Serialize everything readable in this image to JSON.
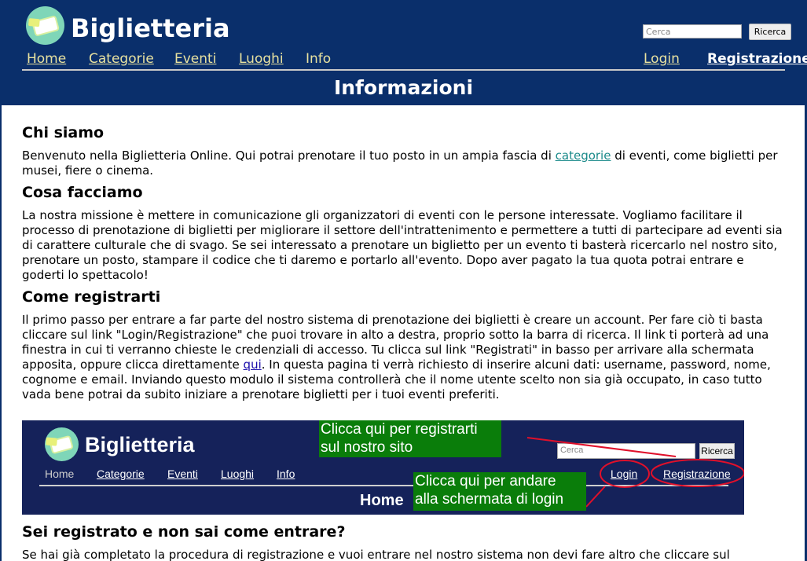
{
  "header": {
    "site_title": "Biglietteria",
    "search": {
      "placeholder": "Cerca",
      "button_label": "Ricerca"
    },
    "nav": {
      "home": "Home",
      "categorie": "Categorie",
      "eventi": "Eventi",
      "luoghi": "Luoghi",
      "info": "Info",
      "login": "Login",
      "registrazione": "Registrazione"
    },
    "page_heading": "Informazioni"
  },
  "sections": {
    "chi_siamo": {
      "title": "Chi siamo",
      "text_before_link": "Benvenuto nella Biglietteria Online. Qui potrai prenotare il tuo posto in un ampia fascia di ",
      "link_text": "categorie",
      "text_after_link": " di eventi, come biglietti per musei, fiere o cinema."
    },
    "cosa_facciamo": {
      "title": "Cosa facciamo",
      "text": "La nostra missione è mettere in comunicazione gli organizzatori di eventi con le persone interessate. Vogliamo facilitare il processo di prenotazione di biglietti per migliorare il settore dell'intrattenimento e permettere a tutti di partecipare ad eventi sia di carattere culturale che di svago. Se sei interessato a prenotare un biglietto per un evento ti basterà ricercarlo nel nostro sito, prenotare un posto, stampare il codice che ti daremo e portarlo all'evento. Dopo aver pagato la tua quota potrai entrare e goderti lo spettacolo!"
    },
    "come_registrarti": {
      "title": "Come registrarti",
      "text_before_link": "Il primo passo per entrare a far parte del nostro sistema di prenotazione dei biglietti è creare un account. Per fare ciò ti basta cliccare sul link \"Login/Registrazione\" che puoi trovare in alto a destra, proprio sotto la barra di ricerca. Il link ti porterà ad una finestra in cui ti verranno chieste le credenziali di accesso. Tu clicca sul link \"Registrati\" in basso per arrivare alla schermata apposita, oppure clicca direttamente ",
      "link_text": "qui",
      "text_after_link": ". In questa pagina ti verrà richiesto di inserire alcuni dati: username, password, nome, cognome e email. Inviando questo modulo il sistema controllerà che il nome utente scelto non sia già occupato, in caso tutto vada bene potrai da subito iniziare a prenotare biglietti per i tuoi eventi preferiti."
    },
    "sei_registrato": {
      "title": "Sei registrato e non sai come entrare?",
      "text": "Se hai già completato la procedura di registrazione e vuoi entrare nel nostro sistema non devi fare altro che cliccare sul"
    }
  },
  "screenshot": {
    "site_title": "Biglietteria",
    "search_placeholder": "Cerca",
    "search_button": "Ricerca",
    "nav": {
      "home": "Home",
      "categorie": "Categorie",
      "eventi": "Eventi",
      "luoghi": "Luoghi",
      "info": "Info",
      "login": "Login",
      "registrazione": "Registrazione"
    },
    "heading": "Home",
    "callout_register_line1": "Clicca qui per registrarti",
    "callout_register_line2": "sul nostro sito",
    "callout_login_line1": "Clicca qui per andare",
    "callout_login_line2": "alla schermata di login",
    "annotation_color": "#e0102a",
    "callout_color": "#0a7d0a"
  },
  "colors": {
    "header_bg": "#0a2f6b",
    "nav_link": "#e8e2a0",
    "category_link": "#1a8a8a",
    "qui_link": "#1a0dab"
  }
}
